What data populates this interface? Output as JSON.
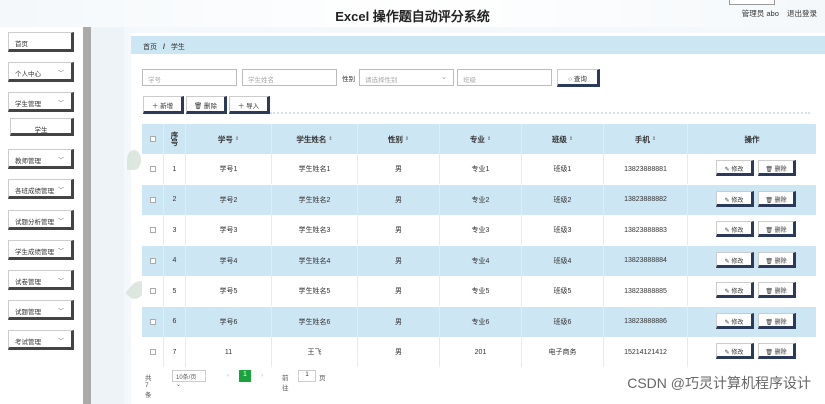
{
  "header": {
    "title": "Excel 操作题自动评分系统",
    "role": "管理员 abo",
    "logout": "退出登录"
  },
  "sidebar": {
    "items": [
      {
        "label": "首页",
        "has_chevron": false
      },
      {
        "label": "个人中心",
        "has_chevron": true
      },
      {
        "label": "学生管理",
        "has_chevron": true
      },
      {
        "label": "学生",
        "sub": true
      },
      {
        "label": "教师管理",
        "has_chevron": true
      },
      {
        "label": "各班成绩管理",
        "has_chevron": true
      },
      {
        "label": "试题分析管理",
        "has_chevron": true
      },
      {
        "label": "学生成绩管理",
        "has_chevron": true
      },
      {
        "label": "试卷管理",
        "has_chevron": true
      },
      {
        "label": "试题管理",
        "has_chevron": true
      },
      {
        "label": "考试管理",
        "has_chevron": true
      }
    ]
  },
  "breadcrumb": {
    "home": "首页",
    "sep": "/",
    "current": "学生"
  },
  "search": {
    "student_no_placeholder": "学号",
    "student_name_placeholder": "学生姓名",
    "gender_label": "性别",
    "gender_placeholder": "请选择性别",
    "class_placeholder": "班级",
    "query_label": "查询"
  },
  "toolbar": {
    "add_label": "新增",
    "delete_label": "删除",
    "import_label": "导入"
  },
  "table": {
    "headers": {
      "index": "序号",
      "no": "学号",
      "name": "学生姓名",
      "gender": "性别",
      "major": "专业",
      "class": "班级",
      "phone": "手机",
      "ops": "操作"
    },
    "edit_label": "修改",
    "delete_label": "删除",
    "rows": [
      {
        "index": "1",
        "no": "学号1",
        "name": "学生姓名1",
        "gender": "男",
        "major": "专业1",
        "class": "班级1",
        "phone": "13823888881"
      },
      {
        "index": "2",
        "no": "学号2",
        "name": "学生姓名2",
        "gender": "男",
        "major": "专业2",
        "class": "班级2",
        "phone": "13823888882"
      },
      {
        "index": "3",
        "no": "学号3",
        "name": "学生姓名3",
        "gender": "男",
        "major": "专业3",
        "class": "班级3",
        "phone": "13823888883"
      },
      {
        "index": "4",
        "no": "学号4",
        "name": "学生姓名4",
        "gender": "男",
        "major": "专业4",
        "class": "班级4",
        "phone": "13823888884"
      },
      {
        "index": "5",
        "no": "学号5",
        "name": "学生姓名5",
        "gender": "男",
        "major": "专业5",
        "class": "班级5",
        "phone": "13823888885"
      },
      {
        "index": "6",
        "no": "学号6",
        "name": "学生姓名6",
        "gender": "男",
        "major": "专业6",
        "class": "班级6",
        "phone": "13823888886"
      },
      {
        "index": "7",
        "no": "11",
        "name": "王飞",
        "gender": "男",
        "major": "201",
        "class": "电子商务",
        "phone": "15214121412"
      }
    ]
  },
  "pagination": {
    "total": "共 7 条",
    "page_size": "10条/页",
    "current": "1",
    "goto": "前往",
    "goto_value": "1",
    "page_unit": "页"
  },
  "watermark": "CSDN @巧灵计算机程序设计"
}
